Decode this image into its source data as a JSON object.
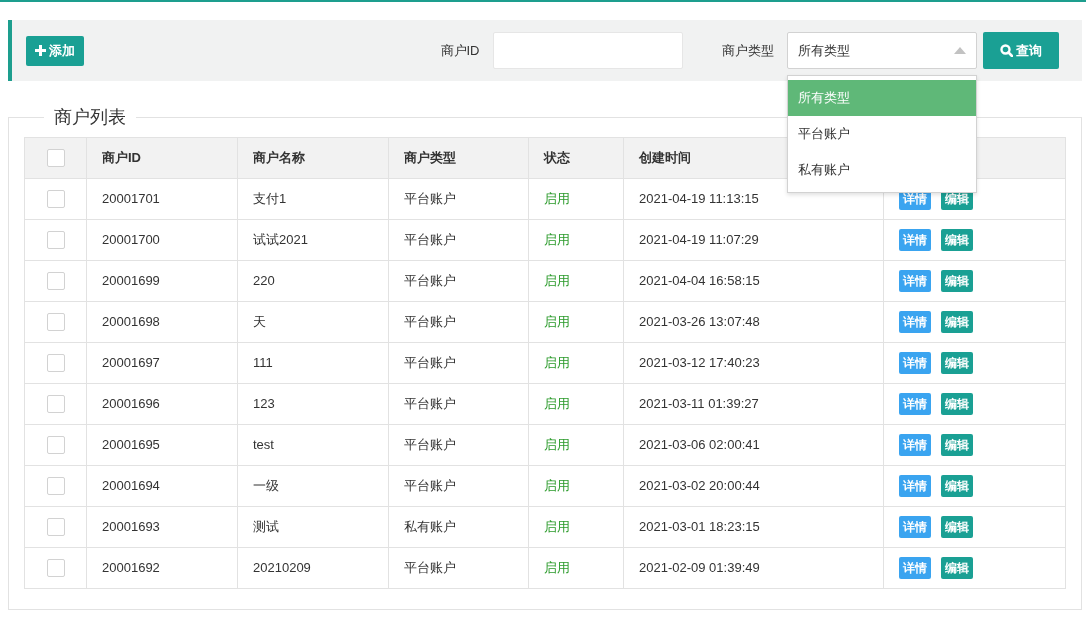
{
  "toolbar": {
    "add_button": "添加",
    "fields": [
      {
        "label": "商户ID"
      }
    ],
    "type_filter": {
      "label": "商户类型",
      "value": "所有类型",
      "expanded": true,
      "options": [
        {
          "label": "所有类型",
          "selected": true
        },
        {
          "label": "平台账户",
          "selected": false
        },
        {
          "label": "私有账户",
          "selected": false
        }
      ]
    },
    "search_button": "查询"
  },
  "panel": {
    "title": "商户列表"
  },
  "table": {
    "select_all": {
      "checked": false
    },
    "columns": [
      "商户ID",
      "商户名称",
      "商户类型",
      "状态",
      "创建时间"
    ],
    "rows": [
      {
        "checked": false,
        "id": "20001701",
        "name": "支付1",
        "type": "平台账户",
        "status": "启用",
        "created": "2021-04-19 11:13:15",
        "actions": [
          "详情",
          "编辑"
        ]
      },
      {
        "checked": false,
        "id": "20001700",
        "name": "试试2021",
        "type": "平台账户",
        "status": "启用",
        "created": "2021-04-19 11:07:29",
        "actions": [
          "详情",
          "编辑"
        ]
      },
      {
        "checked": false,
        "id": "20001699",
        "name": "220",
        "type": "平台账户",
        "status": "启用",
        "created": "2021-04-04 16:58:15",
        "actions": [
          "详情",
          "编辑"
        ]
      },
      {
        "checked": false,
        "id": "20001698",
        "name": "天",
        "type": "平台账户",
        "status": "启用",
        "created": "2021-03-26 13:07:48",
        "actions": [
          "详情",
          "编辑"
        ]
      },
      {
        "checked": false,
        "id": "20001697",
        "name": "111",
        "type": "平台账户",
        "status": "启用",
        "created": "2021-03-12 17:40:23",
        "actions": [
          "详情",
          "编辑"
        ]
      },
      {
        "checked": false,
        "id": "20001696",
        "name": "123",
        "type": "平台账户",
        "status": "启用",
        "created": "2021-03-11 01:39:27",
        "actions": [
          "详情",
          "编辑"
        ]
      },
      {
        "checked": false,
        "id": "20001695",
        "name": "test",
        "type": "平台账户",
        "status": "启用",
        "created": "2021-03-06 02:00:41",
        "actions": [
          "详情",
          "编辑"
        ]
      },
      {
        "checked": false,
        "id": "20001694",
        "name": "一级",
        "type": "平台账户",
        "status": "启用",
        "created": "2021-03-02 20:00:44",
        "actions": [
          "详情",
          "编辑"
        ]
      },
      {
        "checked": false,
        "id": "20001693",
        "name": "测试",
        "type": "私有账户",
        "status": "启用",
        "created": "2021-03-01 18:23:15",
        "actions": [
          "详情",
          "编辑"
        ]
      },
      {
        "checked": false,
        "id": "20001692",
        "name": "20210209",
        "type": "平台账户",
        "status": "启用",
        "created": "2021-02-09 01:39:49",
        "actions": [
          "详情",
          "编辑"
        ]
      }
    ]
  }
}
